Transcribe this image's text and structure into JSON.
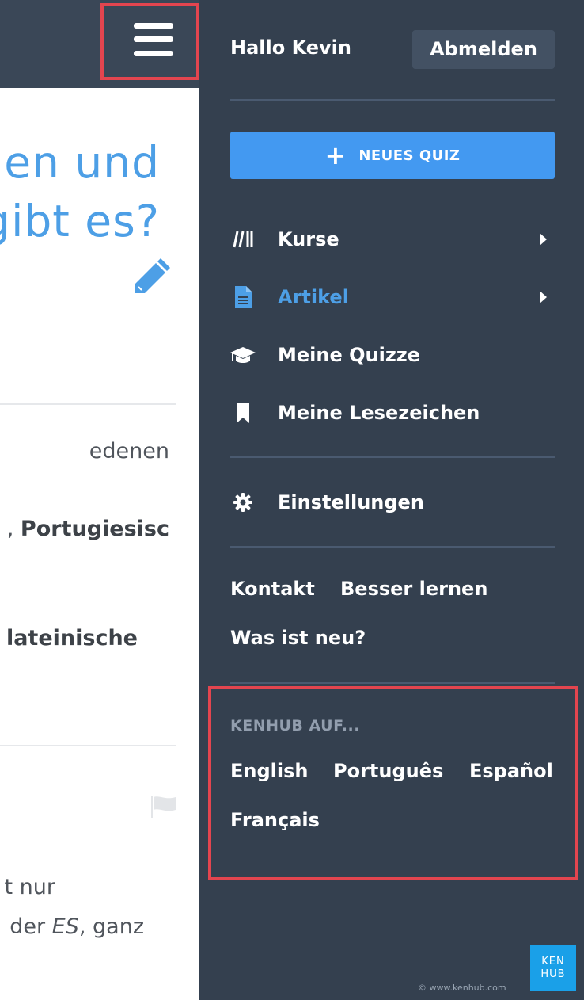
{
  "page": {
    "title_lines": [
      "en und",
      "gibt es?"
    ],
    "body_lines": {
      "line1": "edenen",
      "line2_sep": ", ",
      "line2_bold": "Portugiesisc",
      "line3_bold": "lateinische",
      "line4": "t nur",
      "line5_pre": "der ",
      "line5_italic": "ES",
      "line5_post": ", ganz"
    }
  },
  "drawer": {
    "greeting": "Hallo Kevin",
    "logout_label": "Abmelden",
    "new_quiz_icon": "+",
    "new_quiz_label": "NEUES QUIZ",
    "nav": [
      {
        "label": "Kurse",
        "icon": "courses-icon",
        "has_submenu": true,
        "active": false
      },
      {
        "label": "Artikel",
        "icon": "article-icon",
        "has_submenu": true,
        "active": true
      },
      {
        "label": "Meine Quizze",
        "icon": "graduation-cap-icon",
        "has_submenu": false,
        "active": false
      },
      {
        "label": "Meine Lesezeichen",
        "icon": "bookmark-icon",
        "has_submenu": false,
        "active": false
      }
    ],
    "settings_label": "Einstellungen",
    "links": {
      "contact": "Kontakt",
      "learn_better": "Besser lernen",
      "whats_new": "Was ist neu?"
    },
    "languages": {
      "heading": "KENHUB AUF...",
      "items": [
        "English",
        "Português",
        "Español",
        "Français"
      ]
    },
    "logo_text": [
      "KEN",
      "HUB"
    ],
    "copyright": "© www.kenhub.com"
  },
  "colors": {
    "accent": "#4d9fe6",
    "button_blue": "#4399f1",
    "drawer_bg": "#34404f",
    "highlight": "#e3454f",
    "logo_bg": "#1aa0e8"
  }
}
